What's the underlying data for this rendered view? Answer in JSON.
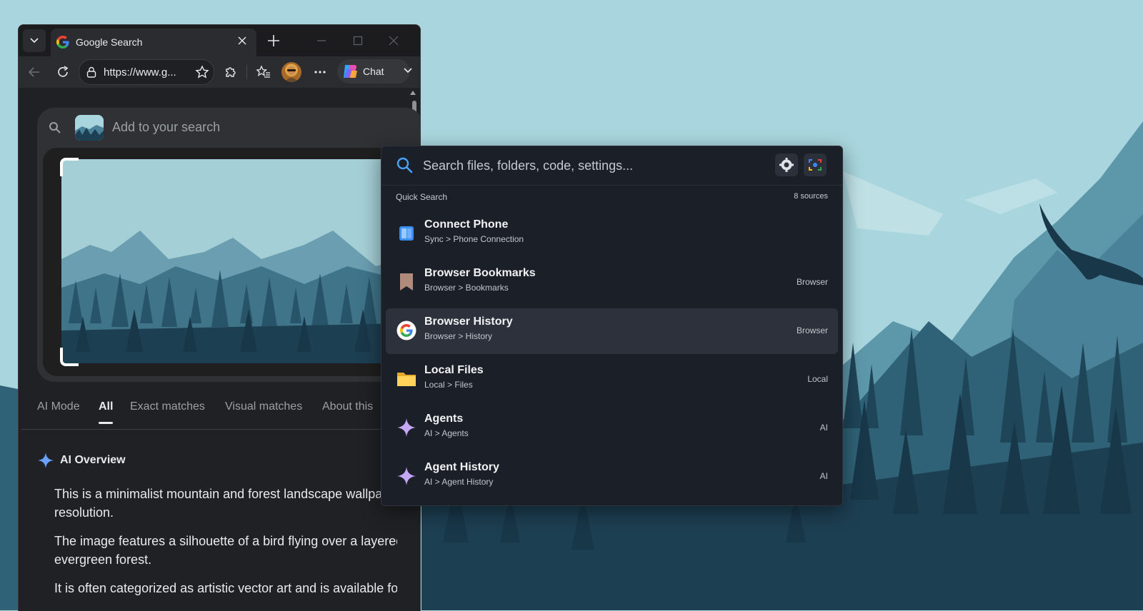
{
  "browser": {
    "tab_title": "Google Search",
    "address_url": "https://www.g...",
    "chat_label": "Chat"
  },
  "lens": {
    "search_placeholder": "Add to your search"
  },
  "result_tabs": [
    {
      "label": "AI Mode",
      "active": false
    },
    {
      "label": "All",
      "active": true
    },
    {
      "label": "Exact matches",
      "active": false
    },
    {
      "label": "Visual matches",
      "active": false
    },
    {
      "label": "About this",
      "active": false
    }
  ],
  "ai_overview": {
    "title": "AI Overview",
    "bullets": [
      "This is a minimalist mountain and forest landscape wallpaper",
      "resolution.",
      "The image features a silhouette of a bird flying over a layered",
      "evergreen forest.",
      "It is often categorized as artistic vector art and is available fo"
    ]
  },
  "palette": {
    "search_placeholder": "Search files, folders, code, settings...",
    "section_label": "Quick Search",
    "sources_count": "8 sources",
    "items": [
      {
        "title": "Connect Phone",
        "path": "Sync > Phone Connection",
        "source": "",
        "icon": "phone-icon",
        "selected": false
      },
      {
        "title": "Browser Bookmarks",
        "path": "Browser > Bookmarks",
        "source": "Browser",
        "icon": "bookmark-icon",
        "selected": false
      },
      {
        "title": "Browser History",
        "path": "Browser > History",
        "source": "Browser",
        "icon": "google-icon",
        "selected": true
      },
      {
        "title": "Local Files",
        "path": "Local > Files",
        "source": "Local",
        "icon": "folder-icon",
        "selected": false
      },
      {
        "title": "Agents",
        "path": "AI > Agents",
        "source": "AI",
        "icon": "sparkle-icon",
        "selected": false
      },
      {
        "title": "Agent History",
        "path": "AI > Agent History",
        "source": "AI",
        "icon": "sparkle-icon",
        "selected": false
      }
    ]
  },
  "colors": {
    "sky": "#a9d6de",
    "palette_bg": "#1b1f27",
    "selected_row": "#2c313b",
    "browser_bg": "#202124"
  }
}
